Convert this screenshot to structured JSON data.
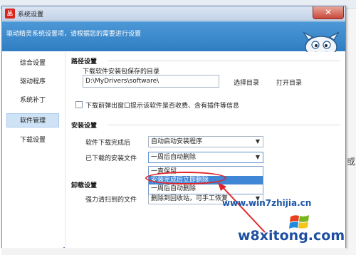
{
  "window": {
    "app_logo": "丛",
    "title": "系统设置",
    "close_glyph": "✕",
    "banner_text": "驱动精灵系统设置项，请根据您的需要进行设置"
  },
  "nav": {
    "items": [
      {
        "label": "综合设置",
        "active": false
      },
      {
        "label": "驱动程序",
        "active": false
      },
      {
        "label": "系统补丁",
        "active": false
      },
      {
        "label": "软件管理",
        "active": true
      },
      {
        "label": "下载设置",
        "active": false
      }
    ]
  },
  "path_section": {
    "title": "路径设置",
    "dir_label": "下载软件安装包保存的目录",
    "dir_value": "D:\\MyDrivers\\software\\",
    "choose_dir": "选择目录",
    "open_dir": "打开目录",
    "popup_checkbox_label": "下载前弹出窗口提示该软件是否收费、含有插件等信息",
    "popup_checkbox_checked": false
  },
  "install_section": {
    "title": "安装设置",
    "after_download_label": "软件下载完成后",
    "after_download_value": "自动启动安装程序",
    "downloaded_files_label": "已下载的安装文件",
    "downloaded_files_value": "一周后自动删除",
    "dropdown_options": [
      "一直保留",
      "安装完成后立即删除",
      "一周后自动删除"
    ],
    "highlighted_option_index": 1
  },
  "uninstall_section": {
    "title": "卸载设置",
    "force_clean_label": "强力清扫到的文件",
    "force_clean_value": "删除到回收站，可手工恢复"
  },
  "background": {
    "right_glyph": "或"
  },
  "watermark": {
    "top": "www.win7zhijia.cn",
    "bottom": "w8xitong.com"
  },
  "colors": {
    "banner": "#3a87c9",
    "highlight": "#3f86d6",
    "annotation": "#e0242a",
    "close_button": "#c9483a"
  },
  "icons": {
    "close": "close-icon",
    "caret": "chevron-down-icon",
    "mascot": "mascot-icon",
    "logo": "app-logo-icon"
  }
}
